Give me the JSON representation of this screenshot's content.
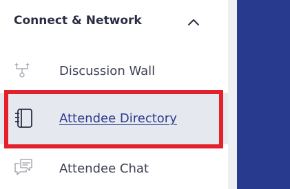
{
  "section": {
    "title": "Connect & Network",
    "expanded": true
  },
  "nav": {
    "items": [
      {
        "label": "Discussion Wall",
        "icon": "discussion-wall-icon",
        "selected": false
      },
      {
        "label": "Attendee Directory",
        "icon": "attendee-directory-icon",
        "selected": true
      },
      {
        "label": "Attendee Chat",
        "icon": "attendee-chat-icon",
        "selected": false
      }
    ]
  },
  "colors": {
    "main_panel": "#283a8d",
    "selected_bg": "#e6e8f0",
    "highlight": "#e4202a",
    "selected_text": "#2a3b8a"
  }
}
